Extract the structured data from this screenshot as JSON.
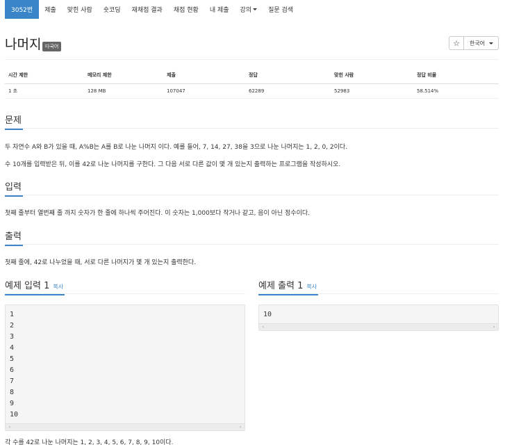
{
  "nav": {
    "tabs": [
      {
        "label": "3052번",
        "active": true
      },
      {
        "label": "제출"
      },
      {
        "label": "맞힌 사람"
      },
      {
        "label": "숏코딩"
      },
      {
        "label": "재채점 결과"
      },
      {
        "label": "채점 현황"
      },
      {
        "label": "내 제출"
      },
      {
        "label": "강의",
        "dropdown": true
      },
      {
        "label": "질문 검색"
      }
    ]
  },
  "problem": {
    "title": "나머지",
    "badge": "다국어",
    "star": "☆",
    "language": "한국어"
  },
  "info_table": {
    "headers": [
      "시간 제한",
      "메모리 제한",
      "제출",
      "정답",
      "맞힌 사람",
      "정답 비율"
    ],
    "values": [
      "1 초",
      "128 MB",
      "107047",
      "62289",
      "52983",
      "58.514%"
    ]
  },
  "sections": {
    "problem_heading": "문제",
    "problem_text_1": "두 자연수 A와 B가 있을 때, A%B는 A를 B로 나눈 나머지 이다. 예를 들어, 7, 14, 27, 38을 3으로 나눈 나머지는 1, 2, 0, 2이다.",
    "problem_text_2": "수 10개를 입력받은 뒤, 이를 42로 나눈 나머지를 구한다. 그 다음 서로 다른 값이 몇 개 있는지 출력하는 프로그램을 작성하시오.",
    "input_heading": "입력",
    "input_text": "첫째 줄부터 열번째 줄 까지 숫자가 한 줄에 하나씩 주어진다. 이 숫자는 1,000보다 작거나 같고, 음이 아닌 정수이다.",
    "output_heading": "출력",
    "output_text": "첫째 줄에, 42로 나누었을 때, 서로 다른 나머지가 몇 개 있는지 출력한다."
  },
  "sample": {
    "input_heading": "예제 입력 1",
    "output_heading": "예제 출력 1",
    "copy_label": "복사",
    "input_lines": [
      "1",
      "2",
      "3",
      "4",
      "5",
      "6",
      "7",
      "8",
      "9",
      "10"
    ],
    "output_lines": [
      "10"
    ],
    "scroll_left": "‹",
    "scroll_right": "›",
    "note": "각 수를 42로 나눈 나머지는 1, 2, 3, 4, 5, 6, 7, 8, 9, 10이다."
  }
}
